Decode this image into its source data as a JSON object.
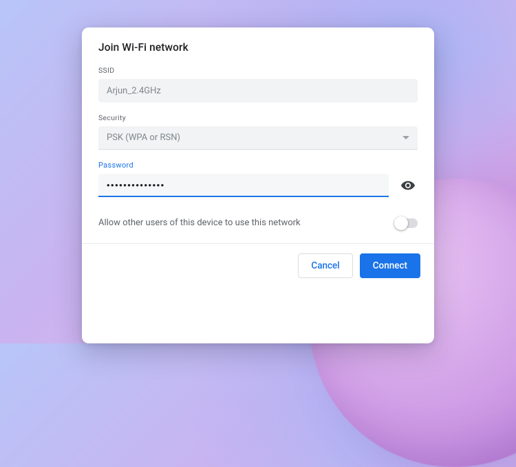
{
  "dialog": {
    "title": "Join Wi-Fi network",
    "fields": {
      "ssid": {
        "label": "SSID",
        "value": "Arjun_2.4GHz"
      },
      "security": {
        "label": "Security",
        "value": "PSK (WPA or RSN)"
      },
      "password": {
        "label": "Password",
        "value": "••••••••••••••"
      }
    },
    "allow_other_users_label": "Allow other users of this device to use this network",
    "allow_other_users": false
  },
  "actions": {
    "cancel": "Cancel",
    "connect": "Connect"
  },
  "icons": {
    "eye": "eye-icon",
    "caret": "chevron-down-icon"
  },
  "colors": {
    "accent": "#1a73e8"
  }
}
